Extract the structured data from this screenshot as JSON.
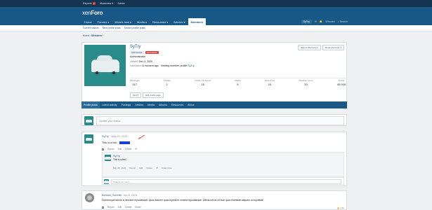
{
  "topbar": {
    "reports": "Reports",
    "reports_count": "1",
    "moderator": "Moderator",
    "moderator_arrow": "▾",
    "admin": "Admin"
  },
  "logo": {
    "part1": "xen",
    "part2": "Foro"
  },
  "nav": {
    "tabs": [
      {
        "label": "Home"
      },
      {
        "label": "Forums ▾"
      },
      {
        "label": "What's new ▾"
      },
      {
        "label": "Media ▾"
      },
      {
        "label": "Resources ▾"
      },
      {
        "label": "Articles ▾"
      },
      {
        "label": "Members"
      }
    ],
    "user": "SyTry",
    "whoosh": "Whoosh",
    "search": "Search"
  },
  "subnav": {
    "items": [
      "Current visitors",
      "New profile posts",
      "Search profile posts"
    ]
  },
  "breadcrumb": {
    "home": "Home",
    "members": "Members"
  },
  "profile": {
    "name": "SyTry",
    "banner_staff": "Staff member",
    "banner_admin": "Administrator",
    "title": "Administrator",
    "joined_label": "Joined:",
    "joined": "Dec 3, 2020",
    "lastseen_label": "Last seen:",
    "lastseen": "A moment ago · Viewing member profile",
    "lastseen_link": "SyTry",
    "edit_banner": "Edit profile banner",
    "moderator_tools": "Moderator tools ▾",
    "find": "Find ▾",
    "edit_profile": "Edit profile page",
    "stats": [
      {
        "label": "Messages",
        "value": "117"
      },
      {
        "label": "Articles",
        "value": "1"
      },
      {
        "label": "Article comments",
        "value": "15"
      },
      {
        "label": "Media",
        "value": "6"
      },
      {
        "label": "Resources",
        "value": "10"
      },
      {
        "label": "Reaction score",
        "value": "20"
      },
      {
        "label": "Points",
        "value": "40,018"
      }
    ]
  },
  "tabs": [
    "Profile posts",
    "Latest activity",
    "Postings",
    "Articles",
    "Media",
    "Albums",
    "Resources",
    "About"
  ],
  "status_placeholder": "Update your status...",
  "post1": {
    "author": "SyTry",
    "date": "· May 25, 2022",
    "text": "This is a link :",
    "link": "link",
    "actions": [
      "Report",
      "Edit",
      "Delete",
      "IP"
    ]
  },
  "reply": {
    "author": "SyTry",
    "text": "This is a test !",
    "date": "May 25, 2022",
    "actions": [
      "Report",
      "Edit",
      "Delete",
      "IP",
      "Unapprove"
    ]
  },
  "comment_placeholder": "Write a comment...",
  "post2": {
    "author": "Bernice_Schmitt",
    "date": "· Apr 6, 2021",
    "text": "Doloremque facere a nesciunt repudiandae. Quia dolorem quia impedit et minima repudiandae. Officia omnis sit eum quia molestiae aliquam ut cupiditate.",
    "actions": [
      "Report",
      "Edit",
      "Delete",
      "Share"
    ],
    "like": "Like"
  },
  "colors": {
    "header": "#185886",
    "topbar": "#15344f",
    "accent": "#2a8c8a",
    "admin_banner": "#dd3a3a",
    "arrow": "#e03030"
  }
}
